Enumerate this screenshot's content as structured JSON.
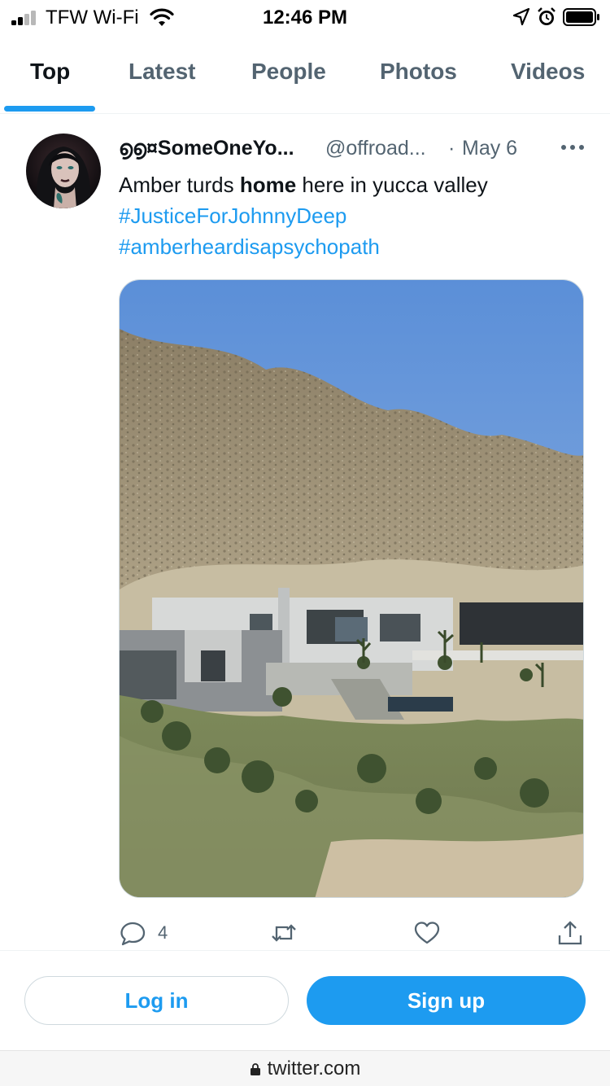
{
  "status_bar": {
    "carrier": "TFW Wi-Fi",
    "time": "12:46 PM",
    "icons": [
      "signal-icon",
      "wifi-icon",
      "location-icon",
      "alarm-icon",
      "battery-icon"
    ]
  },
  "tabs": [
    {
      "label": "Top",
      "active": true
    },
    {
      "label": "Latest",
      "active": false
    },
    {
      "label": "People",
      "active": false
    },
    {
      "label": "Photos",
      "active": false
    },
    {
      "label": "Videos",
      "active": false
    }
  ],
  "tweet": {
    "display_name": "൭൭¤SomeOneYo...",
    "handle": "@offroad...",
    "separator": "·",
    "date": "May 6",
    "text_before": "Amber turds ",
    "text_bold": "home",
    "text_after": " here in yucca valley",
    "hashtags": [
      "#JusticeForJohnnyDeep",
      "#amberheardisapsychopath"
    ],
    "reply_count": "4",
    "more_icon": "more-icon"
  },
  "bottom": {
    "login_label": "Log in",
    "signup_label": "Sign up"
  },
  "browser": {
    "url": "twitter.com"
  },
  "colors": {
    "accent": "#1d9bf0",
    "text_primary": "#0f1419",
    "text_secondary": "#536471"
  }
}
